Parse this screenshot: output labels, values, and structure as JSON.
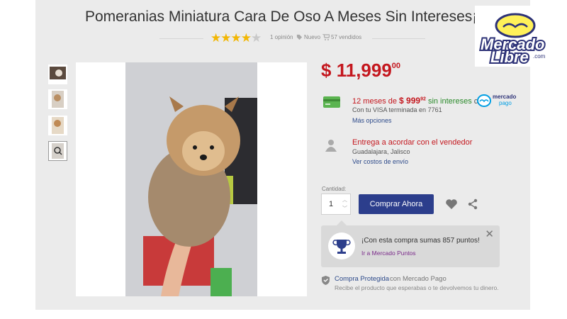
{
  "product": {
    "title": "Pomeranias Miniatura Cara De Oso A Meses Sin Intereses¡",
    "rating_stars": 4,
    "rating_max": 5,
    "reviews": "1 opinión",
    "condition": "Nuevo",
    "sold": "57 vendidos"
  },
  "logo": {
    "line1": "Mercado",
    "line2": "Libre",
    "suffix": ".com"
  },
  "price": {
    "currency": "$",
    "integer": "11,999",
    "cents": "00"
  },
  "installments": {
    "prefix": "12 meses de",
    "amount": "$ 999",
    "cents": "92",
    "free_label": "sin intereses",
    "with": "con",
    "mp_line1": "mercado",
    "mp_line2": "pago",
    "card": "Con tu VISA terminada en 7761",
    "more": "Más opciones"
  },
  "shipping": {
    "title": "Entrega a acordar con el vendedor",
    "location": "Guadalajara, Jalisco",
    "link": "Ver costos de envío"
  },
  "purchase": {
    "qty_label": "Cantidad:",
    "qty_value": "1",
    "buy_label": "Comprar Ahora"
  },
  "points": {
    "message": "¡Con esta compra sumas 857 puntos!",
    "link": "Ir a Mercado Puntos"
  },
  "protection": {
    "title": "Compra Protegida",
    "with": "con Mercado Pago",
    "desc": "Recibe el producto que esperabas o te devolvemos tu dinero."
  },
  "colors": {
    "accent": "#2c3e8c",
    "price": "#c4171e",
    "star": "#f2b705",
    "mp_blue": "#009ee3"
  },
  "icons": [
    "star-icon",
    "tag-icon",
    "cart-icon",
    "credit-card-icon",
    "user-icon",
    "heart-icon",
    "share-icon",
    "trophy-icon",
    "close-icon",
    "shield-icon",
    "zoom-icon"
  ]
}
